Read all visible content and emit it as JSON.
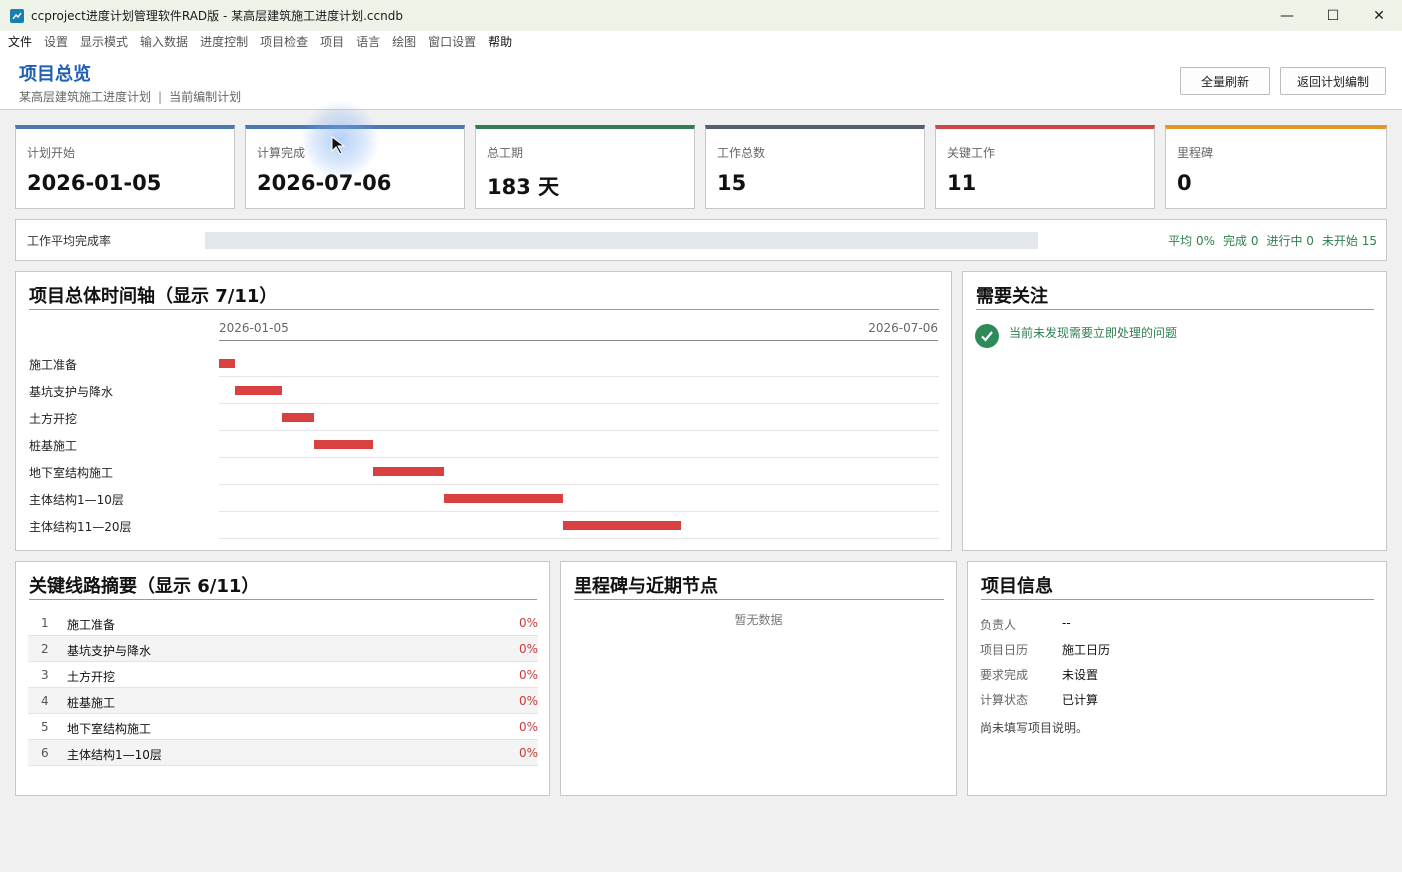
{
  "window": {
    "title": "ccproject进度计划管理软件RAD版 - 某高层建筑施工进度计划.ccndb",
    "controls": [
      "—",
      "☐",
      "✕"
    ]
  },
  "menu": [
    "文件",
    "设置",
    "显示模式",
    "输入数据",
    "进度控制",
    "项目检查",
    "项目",
    "语言",
    "绘图",
    "窗口设置",
    "帮助"
  ],
  "header": {
    "title": "项目总览",
    "project_name": "某高层建筑施工进度计划",
    "separator": "|",
    "plan_mode": "当前编制计划",
    "refresh_button": "全量刷新",
    "back_button": "返回计划编制"
  },
  "stats": [
    {
      "label": "计划开始",
      "value": "2026-01-05",
      "accent": "#4a78b5"
    },
    {
      "label": "计算完成",
      "value": "2026-07-06",
      "accent": "#4a78b5"
    },
    {
      "label": "总工期",
      "value": "183 天",
      "accent": "#2f7f4f"
    },
    {
      "label": "工作总数",
      "value": "15",
      "accent": "#555e6e"
    },
    {
      "label": "关键工作",
      "value": "11",
      "accent": "#d44545"
    },
    {
      "label": "里程碑",
      "value": "0",
      "accent": "#e0962a"
    }
  ],
  "progress": {
    "label": "工作平均完成率",
    "percent": 0,
    "stats": [
      "平均 0%",
      "完成 0",
      "进行中 0",
      "未开始 15"
    ]
  },
  "timeline": {
    "title": "项目总体时间轴（显示 7/11）",
    "start_date": "2026-01-05",
    "end_date": "2026-07-06",
    "total_days": 182,
    "bar_color": "#d94040",
    "rows": [
      {
        "label": "施工准备",
        "start": 0,
        "end": 4
      },
      {
        "label": "基坑支护与降水",
        "start": 4,
        "end": 16
      },
      {
        "label": "土方开挖",
        "start": 16,
        "end": 24
      },
      {
        "label": "桩基施工",
        "start": 24,
        "end": 39
      },
      {
        "label": "地下室结构施工",
        "start": 39,
        "end": 57
      },
      {
        "label": "主体结构1—10层",
        "start": 57,
        "end": 87
      },
      {
        "label": "主体结构11—20层",
        "start": 87,
        "end": 117
      }
    ]
  },
  "attention": {
    "title": "需要关注",
    "message": "当前未发现需要立即处理的问题",
    "icon": "check-circle-icon"
  },
  "critical_path": {
    "title": "关键线路摘要（显示 6/11）",
    "rows": [
      {
        "index": "1",
        "name": "施工准备",
        "percent": "0%"
      },
      {
        "index": "2",
        "name": "基坑支护与降水",
        "percent": "0%"
      },
      {
        "index": "3",
        "name": "土方开挖",
        "percent": "0%"
      },
      {
        "index": "4",
        "name": "桩基施工",
        "percent": "0%"
      },
      {
        "index": "5",
        "name": "地下室结构施工",
        "percent": "0%"
      },
      {
        "index": "6",
        "name": "主体结构1—10层",
        "percent": "0%"
      }
    ]
  },
  "milestones": {
    "title": "里程碑与近期节点",
    "empty": "暂无数据"
  },
  "project_info": {
    "title": "项目信息",
    "rows": [
      {
        "key": "负责人",
        "value": "--"
      },
      {
        "key": "项目日历",
        "value": "施工日历"
      },
      {
        "key": "要求完成",
        "value": "未设置"
      },
      {
        "key": "计算状态",
        "value": "已计算"
      }
    ],
    "note": "尚未填写项目说明。"
  }
}
